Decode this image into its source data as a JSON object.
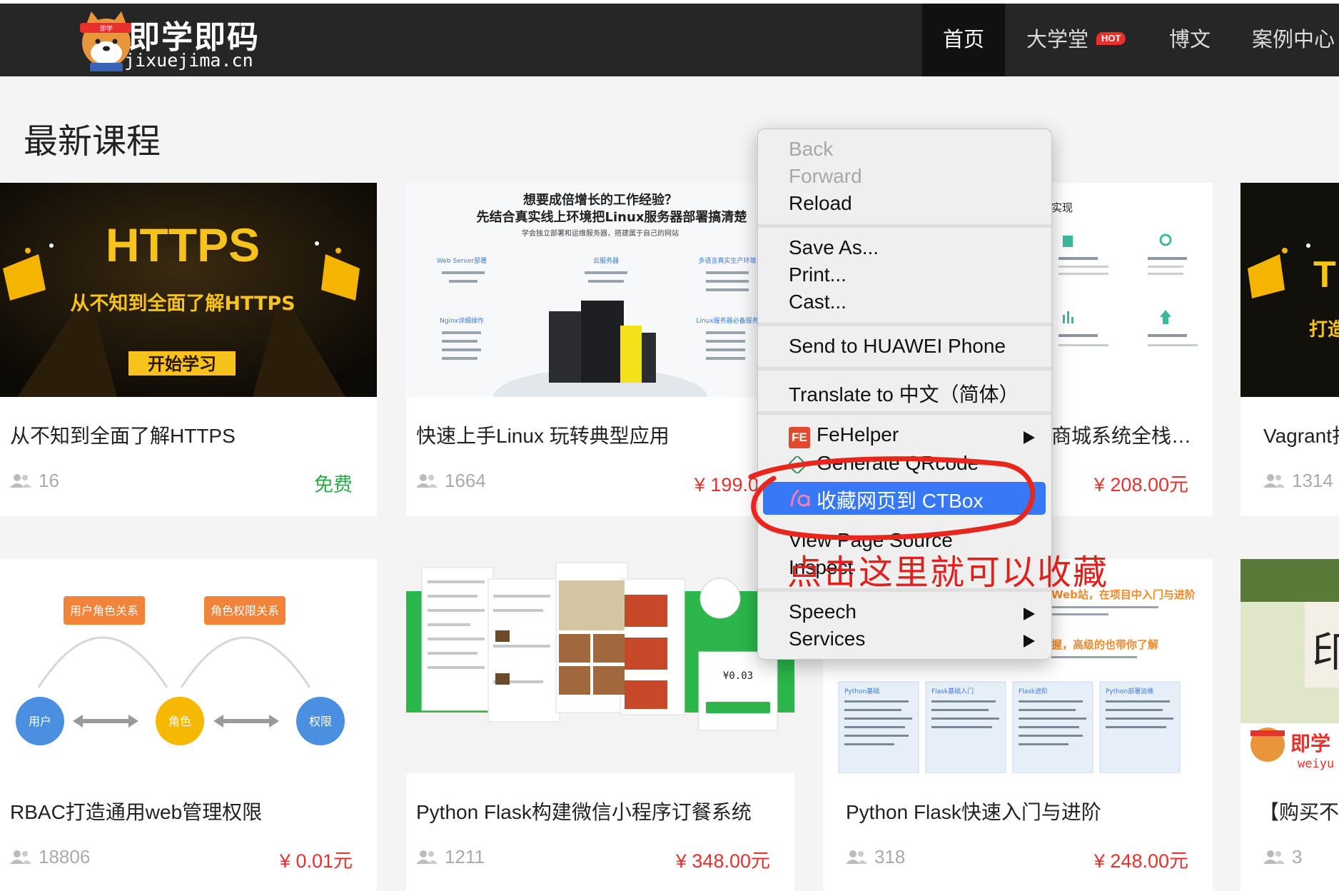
{
  "header": {
    "logo_title": "即学即码",
    "logo_subtitle": "jixuejima.cn",
    "nav": [
      {
        "label": "首页",
        "active": true
      },
      {
        "label": "大学堂",
        "badge": "HOT"
      },
      {
        "label": "博文"
      },
      {
        "label": "案例中心"
      }
    ]
  },
  "section_title": "最新课程",
  "thumbs": {
    "https_title": "HTTPS",
    "https_sub": "从不知到全面了解HTTPS",
    "https_btn": "开始学习",
    "linux_q1": "想要成倍增长的工作经验？",
    "linux_q2": "先结合真实线上环境把Linux服务器部署搞清楚",
    "linux_q3": "学会独立部署和运维服务器，搭建属于自己的网站",
    "linux_cols": [
      "Web Server部署",
      "云服务器",
      "多语言真实生产环境",
      "Nginx详细操作",
      "Linux服务器必备服务"
    ],
    "mall_head": "实现",
    "rbac_role_rel": "用户角色关系",
    "rbac_perm_rel": "角色权限关系",
    "rbac_user": "用户",
    "rbac_role": "角色",
    "rbac_perm": "权限",
    "flask_banner1": "Web站，在项目中入门与进阶",
    "flask_banner2": "握，高级的也带你了解",
    "flask_cols": [
      "Python基础",
      "Flask基础入门",
      "Flask进阶",
      "Python部署运维"
    ],
    "vagrant_text": "打造",
    "weiyu_logo": "即学",
    "weiyu_sub": "weiyu",
    "mini_price": "¥0.03"
  },
  "courses": [
    {
      "title": "从不知到全面了解HTTPS",
      "students": "16",
      "price": "免费",
      "free": true
    },
    {
      "title": "快速上手Linux 玩转典型应用",
      "students": "1664",
      "price": "¥ 199.00元"
    },
    {
      "title": "商城系统全栈…",
      "students": "",
      "price": "¥ 208.00元"
    },
    {
      "title": "Vagrant打",
      "students": "1314",
      "price": ""
    },
    {
      "title": "RBAC打造通用web管理权限",
      "students": "18806",
      "price": "¥ 0.01元"
    },
    {
      "title": "Python Flask构建微信小程序订餐系统",
      "students": "1211",
      "price": "¥ 348.00元"
    },
    {
      "title": "Python Flask快速入门与进阶",
      "students": "318",
      "price": "¥ 248.00元"
    },
    {
      "title": "【购买不",
      "students": "3",
      "price": ""
    }
  ],
  "context_menu": {
    "back": "Back",
    "forward": "Forward",
    "reload": "Reload",
    "save_as": "Save As...",
    "print": "Print...",
    "cast": "Cast...",
    "send_phone": "Send to HUAWEI Phone",
    "translate": "Translate to 中文（简体）",
    "fehelper": "FeHelper",
    "generate_qr": "Generate QRcode",
    "ctbox": "收藏网页到 CTBox",
    "view_source": "View Page Source",
    "inspect": "Inspect",
    "speech": "Speech",
    "services": "Services"
  },
  "annotation": "点击这里就可以收藏",
  "colors": {
    "header_bg": "#262626",
    "price_red": "#e5322d",
    "free_green": "#2eaa48",
    "menu_highlight": "#3778f7",
    "annotation_red": "#e0201c"
  }
}
